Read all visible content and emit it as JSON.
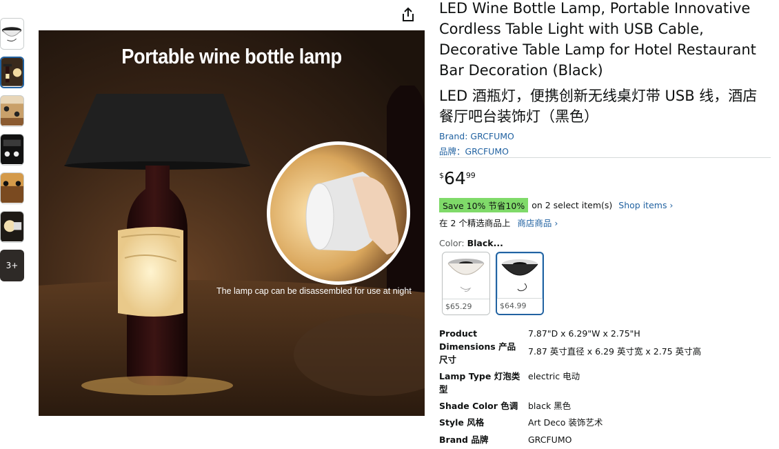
{
  "thumbnails": {
    "more_label": "3+"
  },
  "main_image": {
    "title": "Portable wine bottle lamp",
    "caption": "The lamp cap can be disassembled for use at night"
  },
  "product": {
    "title": "LED Wine Bottle Lamp, Portable Innovative Cordless Table Light with USB Cable, Decorative Table Lamp for Hotel Restaurant Bar Decoration (Black)",
    "title_cn": "LED 酒瓶灯，便携创新无线桌灯带 USB 线，酒店餐厅吧台装饰灯（黑色）",
    "brand_en": "Brand: GRCFUMO",
    "brand_cn": "品牌：GRCFUMO"
  },
  "price": {
    "symbol": "$",
    "whole": "64",
    "fraction": "99"
  },
  "promo": {
    "badge": "Save 10%  节省10%",
    "text": "on 2 select item(s)",
    "link": "Shop items ›",
    "cn_text": "在 2 个精选商品上",
    "cn_link": "商店商品 ›"
  },
  "color": {
    "label": "Color:",
    "value": "Black...",
    "options": [
      {
        "price": "$65.29",
        "name": "white"
      },
      {
        "price": "$64.99",
        "name": "black"
      }
    ]
  },
  "specs": {
    "dimensions_key": "Product Dimensions  产品尺寸",
    "dimensions_val": "7.87\"D x 6.29\"W x 2.75\"H",
    "dimensions_val_cn": "7.87 英寸直径 x 6.29 英寸宽 x 2.75 英寸高",
    "lamp_type_key": "Lamp Type  灯泡类型",
    "lamp_type_val": "electric  电动",
    "shade_color_key": "Shade Color  色调",
    "shade_color_val": "black  黑色",
    "style_key": "Style  风格",
    "style_val": "Art Deco  装饰艺术",
    "brand_key": "Brand  品牌",
    "brand_val": "GRCFUMO"
  },
  "colors": {
    "link": "#2162a1",
    "save_badge": "#7fda69",
    "selected_border": "#2162a1"
  }
}
